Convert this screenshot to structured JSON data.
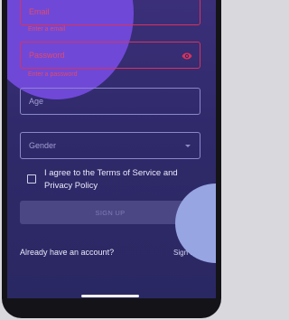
{
  "form": {
    "email": {
      "placeholder": "Email",
      "helper": "Enter a email"
    },
    "password": {
      "placeholder": "Password",
      "helper": "Enter a password"
    },
    "age": {
      "placeholder": "Age"
    },
    "gender": {
      "placeholder": "Gender"
    },
    "terms_label": "I agree to the Terms of Service and Privacy Policy",
    "terms_checked": false,
    "signup_label": "SIGN UP"
  },
  "footer": {
    "have_account": "Already have an account?",
    "signin_label": "Sign In"
  },
  "icons": {
    "password_toggle": "eye-icon",
    "gender_dropdown": "caret-down-icon"
  },
  "colors": {
    "error": "#d8325b",
    "background": "#2f2a6a",
    "accent_purple": "#7048d8",
    "accent_blue": "#97a5e2"
  }
}
